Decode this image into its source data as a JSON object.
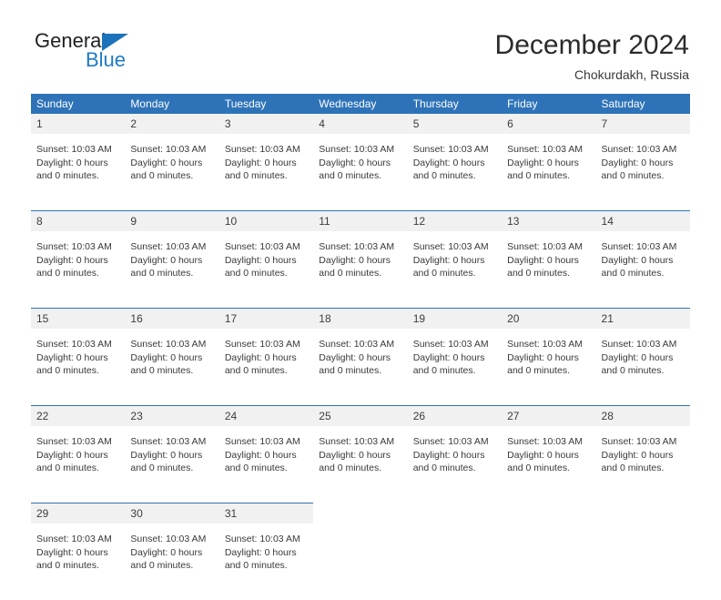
{
  "brand": {
    "name_part1": "General",
    "name_part2": "Blue",
    "triangle_color": "#1c72bb",
    "text_color": "#231f20",
    "blue_text_color": "#1f7ac4"
  },
  "header": {
    "title": "December 2024",
    "subtitle": "Chokurdakh, Russia"
  },
  "theme": {
    "header_blue": "#2e73b8",
    "daynum_bg": "#f1f1f1",
    "body_text": "#39393b"
  },
  "weekdays": [
    "Sunday",
    "Monday",
    "Tuesday",
    "Wednesday",
    "Thursday",
    "Friday",
    "Saturday"
  ],
  "cell_text": {
    "sunset": "Sunset: 10:03 AM",
    "daylight": "Daylight: 0 hours",
    "daylight_cont": "and 0 minutes."
  },
  "weeks": [
    {
      "days": [
        {
          "num": "1",
          "sunset": "Sunset: 10:03 AM",
          "daylight": "Daylight: 0 hours",
          "daylight_cont": "and 0 minutes."
        },
        {
          "num": "2",
          "sunset": "Sunset: 10:03 AM",
          "daylight": "Daylight: 0 hours",
          "daylight_cont": "and 0 minutes."
        },
        {
          "num": "3",
          "sunset": "Sunset: 10:03 AM",
          "daylight": "Daylight: 0 hours",
          "daylight_cont": "and 0 minutes."
        },
        {
          "num": "4",
          "sunset": "Sunset: 10:03 AM",
          "daylight": "Daylight: 0 hours",
          "daylight_cont": "and 0 minutes."
        },
        {
          "num": "5",
          "sunset": "Sunset: 10:03 AM",
          "daylight": "Daylight: 0 hours",
          "daylight_cont": "and 0 minutes."
        },
        {
          "num": "6",
          "sunset": "Sunset: 10:03 AM",
          "daylight": "Daylight: 0 hours",
          "daylight_cont": "and 0 minutes."
        },
        {
          "num": "7",
          "sunset": "Sunset: 10:03 AM",
          "daylight": "Daylight: 0 hours",
          "daylight_cont": "and 0 minutes."
        }
      ]
    },
    {
      "days": [
        {
          "num": "8",
          "sunset": "Sunset: 10:03 AM",
          "daylight": "Daylight: 0 hours",
          "daylight_cont": "and 0 minutes."
        },
        {
          "num": "9",
          "sunset": "Sunset: 10:03 AM",
          "daylight": "Daylight: 0 hours",
          "daylight_cont": "and 0 minutes."
        },
        {
          "num": "10",
          "sunset": "Sunset: 10:03 AM",
          "daylight": "Daylight: 0 hours",
          "daylight_cont": "and 0 minutes."
        },
        {
          "num": "11",
          "sunset": "Sunset: 10:03 AM",
          "daylight": "Daylight: 0 hours",
          "daylight_cont": "and 0 minutes."
        },
        {
          "num": "12",
          "sunset": "Sunset: 10:03 AM",
          "daylight": "Daylight: 0 hours",
          "daylight_cont": "and 0 minutes."
        },
        {
          "num": "13",
          "sunset": "Sunset: 10:03 AM",
          "daylight": "Daylight: 0 hours",
          "daylight_cont": "and 0 minutes."
        },
        {
          "num": "14",
          "sunset": "Sunset: 10:03 AM",
          "daylight": "Daylight: 0 hours",
          "daylight_cont": "and 0 minutes."
        }
      ]
    },
    {
      "days": [
        {
          "num": "15",
          "sunset": "Sunset: 10:03 AM",
          "daylight": "Daylight: 0 hours",
          "daylight_cont": "and 0 minutes."
        },
        {
          "num": "16",
          "sunset": "Sunset: 10:03 AM",
          "daylight": "Daylight: 0 hours",
          "daylight_cont": "and 0 minutes."
        },
        {
          "num": "17",
          "sunset": "Sunset: 10:03 AM",
          "daylight": "Daylight: 0 hours",
          "daylight_cont": "and 0 minutes."
        },
        {
          "num": "18",
          "sunset": "Sunset: 10:03 AM",
          "daylight": "Daylight: 0 hours",
          "daylight_cont": "and 0 minutes."
        },
        {
          "num": "19",
          "sunset": "Sunset: 10:03 AM",
          "daylight": "Daylight: 0 hours",
          "daylight_cont": "and 0 minutes."
        },
        {
          "num": "20",
          "sunset": "Sunset: 10:03 AM",
          "daylight": "Daylight: 0 hours",
          "daylight_cont": "and 0 minutes."
        },
        {
          "num": "21",
          "sunset": "Sunset: 10:03 AM",
          "daylight": "Daylight: 0 hours",
          "daylight_cont": "and 0 minutes."
        }
      ]
    },
    {
      "days": [
        {
          "num": "22",
          "sunset": "Sunset: 10:03 AM",
          "daylight": "Daylight: 0 hours",
          "daylight_cont": "and 0 minutes."
        },
        {
          "num": "23",
          "sunset": "Sunset: 10:03 AM",
          "daylight": "Daylight: 0 hours",
          "daylight_cont": "and 0 minutes."
        },
        {
          "num": "24",
          "sunset": "Sunset: 10:03 AM",
          "daylight": "Daylight: 0 hours",
          "daylight_cont": "and 0 minutes."
        },
        {
          "num": "25",
          "sunset": "Sunset: 10:03 AM",
          "daylight": "Daylight: 0 hours",
          "daylight_cont": "and 0 minutes."
        },
        {
          "num": "26",
          "sunset": "Sunset: 10:03 AM",
          "daylight": "Daylight: 0 hours",
          "daylight_cont": "and 0 minutes."
        },
        {
          "num": "27",
          "sunset": "Sunset: 10:03 AM",
          "daylight": "Daylight: 0 hours",
          "daylight_cont": "and 0 minutes."
        },
        {
          "num": "28",
          "sunset": "Sunset: 10:03 AM",
          "daylight": "Daylight: 0 hours",
          "daylight_cont": "and 0 minutes."
        }
      ]
    },
    {
      "days": [
        {
          "num": "29",
          "sunset": "Sunset: 10:03 AM",
          "daylight": "Daylight: 0 hours",
          "daylight_cont": "and 0 minutes."
        },
        {
          "num": "30",
          "sunset": "Sunset: 10:03 AM",
          "daylight": "Daylight: 0 hours",
          "daylight_cont": "and 0 minutes."
        },
        {
          "num": "31",
          "sunset": "Sunset: 10:03 AM",
          "daylight": "Daylight: 0 hours",
          "daylight_cont": "and 0 minutes."
        },
        {
          "num": "",
          "sunset": "",
          "daylight": "",
          "daylight_cont": ""
        },
        {
          "num": "",
          "sunset": "",
          "daylight": "",
          "daylight_cont": ""
        },
        {
          "num": "",
          "sunset": "",
          "daylight": "",
          "daylight_cont": ""
        },
        {
          "num": "",
          "sunset": "",
          "daylight": "",
          "daylight_cont": ""
        }
      ]
    }
  ]
}
